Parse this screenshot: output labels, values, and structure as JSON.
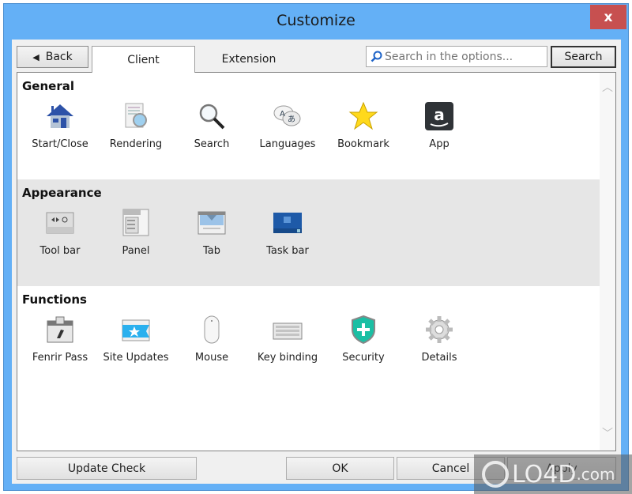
{
  "window": {
    "title": "Customize",
    "close_label": "x"
  },
  "toolbar": {
    "back_label": "Back",
    "tabs": [
      {
        "label": "Client",
        "active": true
      },
      {
        "label": "Extension",
        "active": false
      }
    ],
    "search_placeholder": "Search in the options...",
    "search_button": "Search"
  },
  "sections": [
    {
      "title": "General",
      "items": [
        {
          "label": "Start/Close",
          "icon": "house-icon"
        },
        {
          "label": "Rendering",
          "icon": "document-magnifier-icon"
        },
        {
          "label": "Search",
          "icon": "magnifier-icon"
        },
        {
          "label": "Languages",
          "icon": "speech-bubbles-icon"
        },
        {
          "label": "Bookmark",
          "icon": "star-icon"
        },
        {
          "label": "App",
          "icon": "amazon-icon"
        }
      ]
    },
    {
      "title": "Appearance",
      "items": [
        {
          "label": "Tool bar",
          "icon": "toolbar-icon"
        },
        {
          "label": "Panel",
          "icon": "panel-icon"
        },
        {
          "label": "Tab",
          "icon": "tab-icon"
        },
        {
          "label": "Task bar",
          "icon": "taskbar-icon"
        }
      ]
    },
    {
      "title": "Functions",
      "items": [
        {
          "label": "Fenrir Pass",
          "icon": "fenrir-pass-icon"
        },
        {
          "label": "Site Updates",
          "icon": "ticket-star-icon"
        },
        {
          "label": "Mouse",
          "icon": "mouse-icon"
        },
        {
          "label": "Key binding",
          "icon": "keyboard-icon"
        },
        {
          "label": "Security",
          "icon": "shield-icon"
        },
        {
          "label": "Details",
          "icon": "gear-icon"
        }
      ]
    }
  ],
  "footer": {
    "update_check": "Update Check",
    "ok": "OK",
    "cancel": "Cancel",
    "apply": "Apply"
  },
  "watermark": {
    "text": "LO4D",
    "suffix": ".com"
  }
}
